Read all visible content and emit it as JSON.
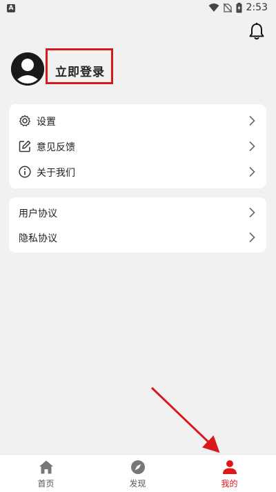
{
  "status_bar": {
    "app_badge": "A",
    "time": "2:53"
  },
  "header": {
    "login_text": "立即登录"
  },
  "menu_group_1": [
    {
      "label": "设置",
      "icon": "gear-icon"
    },
    {
      "label": "意见反馈",
      "icon": "edit-icon"
    },
    {
      "label": "关于我们",
      "icon": "info-icon"
    }
  ],
  "menu_group_2": [
    {
      "label": "用户协议"
    },
    {
      "label": "隐私协议"
    }
  ],
  "bottom_nav": [
    {
      "label": "首页",
      "icon": "home-icon"
    },
    {
      "label": "发现",
      "icon": "compass-icon"
    },
    {
      "label": "我的",
      "icon": "person-icon",
      "active": true
    }
  ],
  "colors": {
    "accent": "#e01515",
    "annotation": "#d8191c",
    "background": "#f1f1f1"
  }
}
